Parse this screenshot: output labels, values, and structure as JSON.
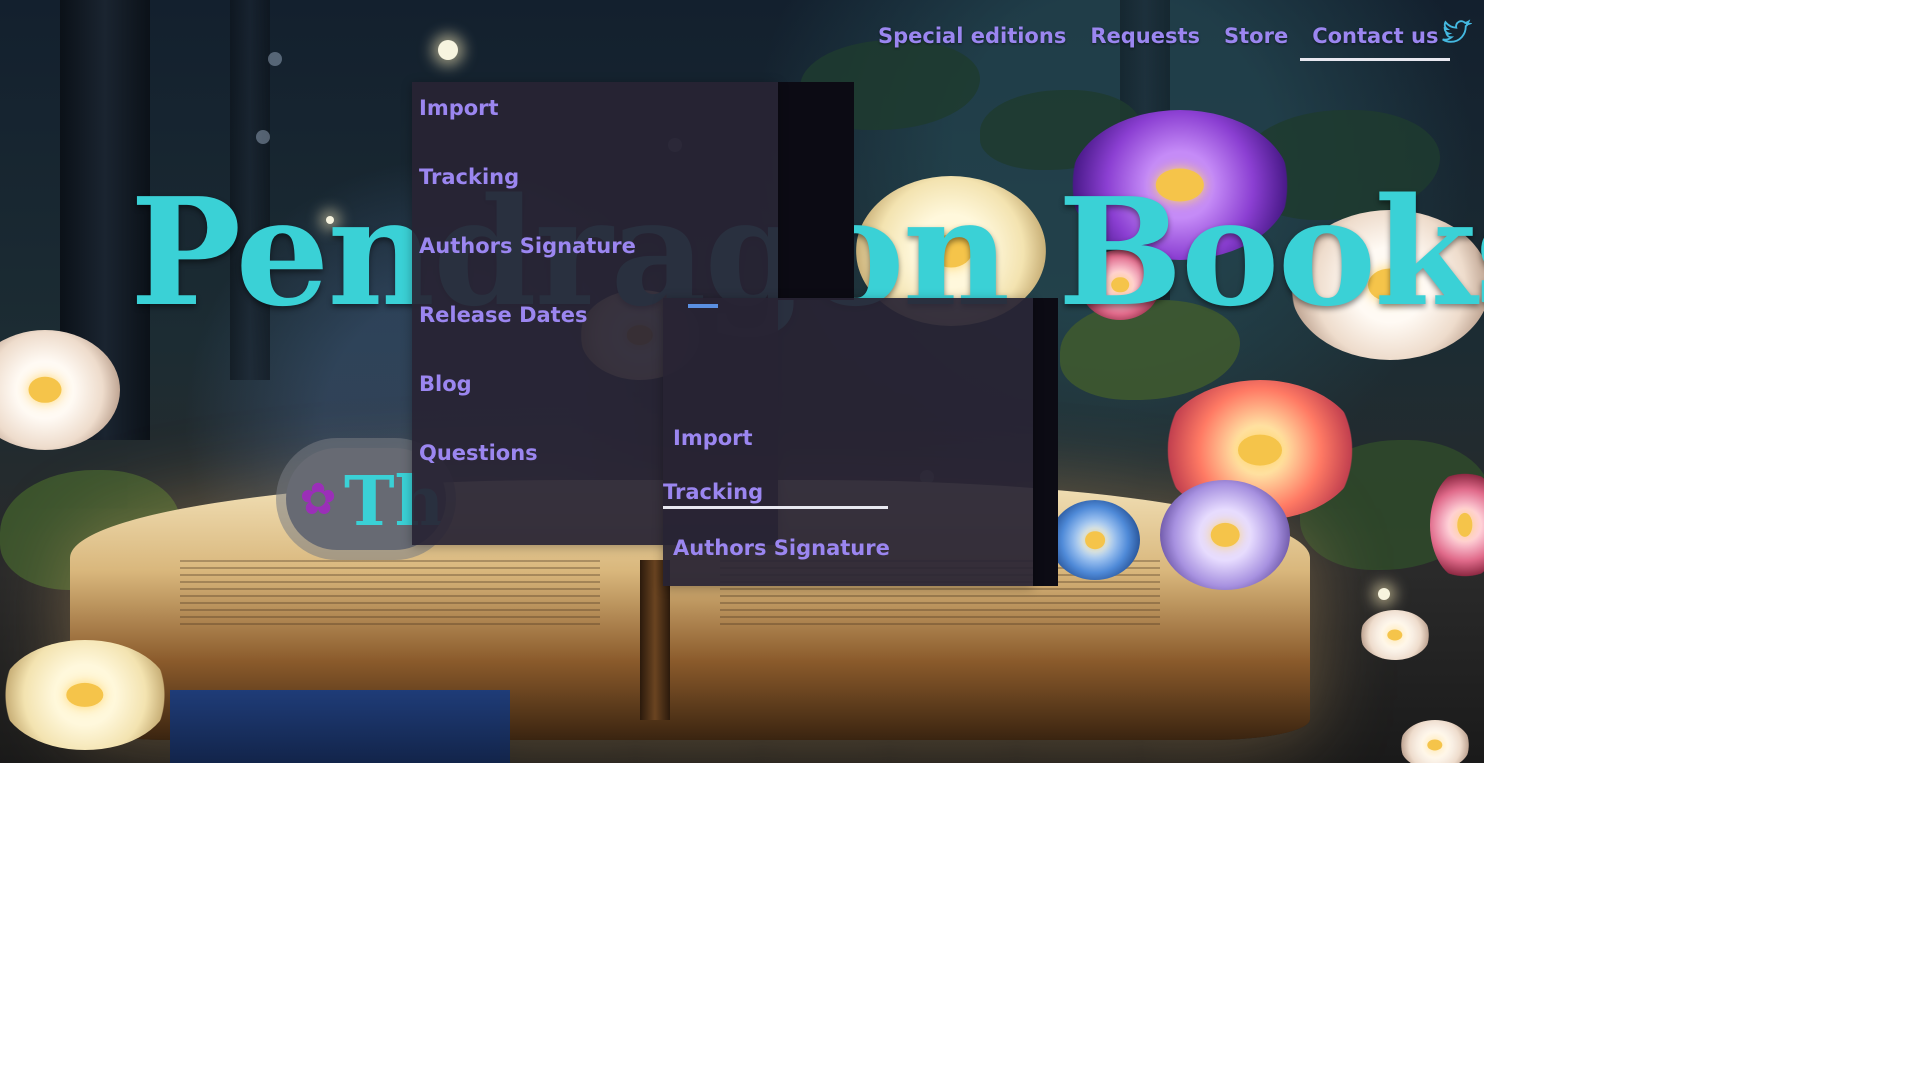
{
  "nav": {
    "links": [
      {
        "label": "Special editions"
      },
      {
        "label": "Requests"
      },
      {
        "label": "Store"
      },
      {
        "label": "Contact us"
      }
    ],
    "active_link": "Contact us",
    "social_icon": "twitter-icon"
  },
  "brand": {
    "title": "Pendragon Books",
    "tagline_fragment": "Th",
    "tagline_icon": "flower-icon"
  },
  "dropdown_primary": {
    "items": [
      {
        "label": "Import"
      },
      {
        "label": "Tracking"
      },
      {
        "label": "Authors Signature"
      },
      {
        "label": "Release Dates"
      },
      {
        "label": "Blog"
      },
      {
        "label": "Questions"
      }
    ]
  },
  "dropdown_secondary": {
    "items": [
      {
        "label": "Import"
      },
      {
        "label": "Tracking"
      },
      {
        "label": "Authors Signature"
      }
    ],
    "highlighted_item": "Tracking"
  },
  "colors": {
    "accent_text": "#9b86f0",
    "title_teal": "#3ad1d6",
    "panel_bg": "#28243a",
    "underline": "#e8e8f0"
  }
}
